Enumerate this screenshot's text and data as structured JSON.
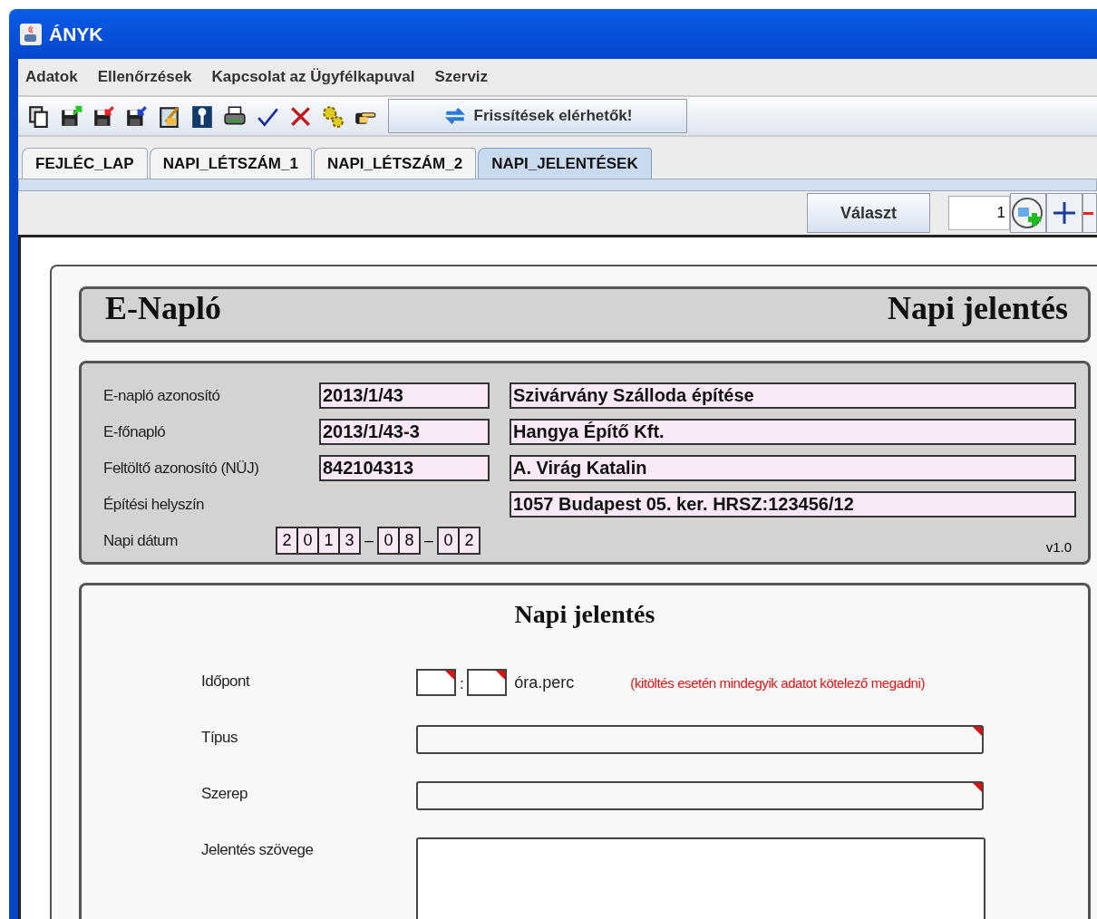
{
  "window": {
    "title": "ÁNYK"
  },
  "menu": [
    "Adatok",
    "Ellenőrzések",
    "Kapcsolat az Ügyfélkapuval",
    "Szerviz"
  ],
  "toolbar": {
    "update_button": "Frissítések elérhetők!"
  },
  "tabs": [
    {
      "label": "FEJLÉC_LAP",
      "selected": false
    },
    {
      "label": "NAPI_LÉTSZÁM_1",
      "selected": false
    },
    {
      "label": "NAPI_LÉTSZÁM_2",
      "selected": false
    },
    {
      "label": "NAPI_JELENTÉSEK",
      "selected": true
    }
  ],
  "page_controls": {
    "choose_button": "Választ",
    "page_number": "1"
  },
  "header": {
    "left": "E-Napló",
    "right": "Napi jelentés"
  },
  "info": {
    "rows": [
      {
        "label": "E-napló azonosító",
        "code": "2013/1/43",
        "value": "Szivárvány Szálloda építése"
      },
      {
        "label": "E-főnapló",
        "code": "2013/1/43-3",
        "value": "Hangya Építő Kft."
      },
      {
        "label": "Feltöltő azonosító (NÜJ)",
        "code": "842104313",
        "value": "A. Virág Katalin"
      },
      {
        "label": "Építési helyszín",
        "value": "1057 Budapest 05. ker. HRSZ:123456/12"
      }
    ],
    "date": {
      "label": "Napi dátum",
      "groups": [
        [
          "2",
          "0",
          "1",
          "3"
        ],
        [
          "0",
          "8"
        ],
        [
          "0",
          "2"
        ]
      ],
      "separator": "–"
    },
    "version": "v1.0"
  },
  "report": {
    "title": "Napi jelentés",
    "time": {
      "label": "Időpont",
      "required": true,
      "separator": ":",
      "unit": "óra.perc",
      "note": "(kitöltés esetén mindegyik adatot kötelező megadni)"
    },
    "fields": [
      {
        "label": "Típus",
        "kind": "line",
        "required": true
      },
      {
        "label": "Szerep",
        "kind": "line",
        "required": true
      },
      {
        "label": "Jelentés szövege",
        "kind": "text"
      }
    ]
  }
}
